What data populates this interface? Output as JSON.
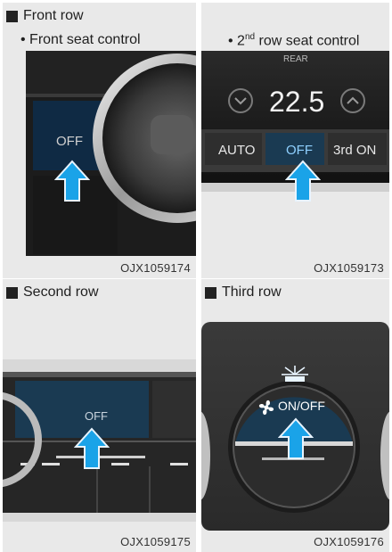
{
  "panels": [
    {
      "heading": "Front row",
      "subheading": "• Front seat control",
      "button_label": "OFF",
      "caption": "OJX1059174"
    },
    {
      "subheading_prefix": "• 2",
      "subheading_sup": "nd",
      "subheading_suffix": " row seat control",
      "rear_label": "REAR",
      "temperature": "22.5",
      "buttons": [
        "AUTO",
        "OFF",
        "3rd ON"
      ],
      "caption": "OJX1059173"
    },
    {
      "heading": "Second row",
      "button_label": "OFF",
      "caption": "OJX1059175"
    },
    {
      "heading": "Third row",
      "button_label": "ON/OFF",
      "caption": "OJX1059176"
    }
  ],
  "colors": {
    "arrow": "#1aa3e8",
    "highlight": "#1a3a52"
  }
}
